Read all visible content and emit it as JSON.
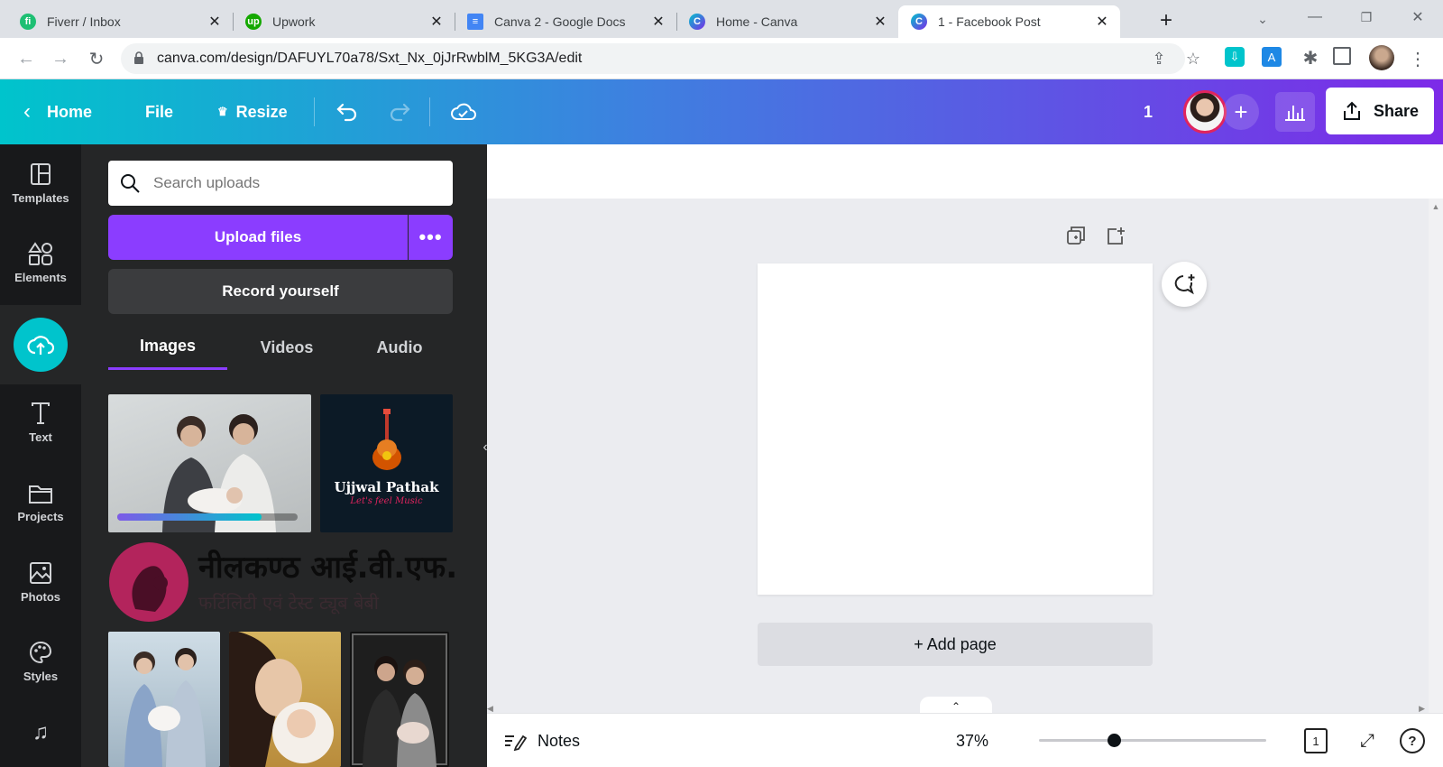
{
  "browser": {
    "tabs": [
      {
        "title": "Fiverr / Inbox",
        "favicon": "fiverr-icon",
        "color": "#1dbf73"
      },
      {
        "title": "Upwork",
        "favicon": "upwork-icon",
        "color": "#14a800"
      },
      {
        "title": "Canva 2 - Google Docs",
        "favicon": "google-docs-icon",
        "color": "#4285f4"
      },
      {
        "title": "Home - Canva",
        "favicon": "canva-icon",
        "color": "#00c4cc"
      },
      {
        "title": "1 - Facebook Post",
        "favicon": "canva-icon",
        "color": "#7d2ae8"
      }
    ],
    "url": "canva.com/design/DAFUYL70a78/Sxt_Nx_0jJrRwblM_5KG3A/edit"
  },
  "toolbar": {
    "home": "Home",
    "file": "File",
    "resize": "Resize",
    "page_count": "1",
    "share": "Share"
  },
  "rail": {
    "templates": "Templates",
    "elements": "Elements",
    "text": "Text",
    "projects": "Projects",
    "photos": "Photos",
    "styles": "Styles"
  },
  "uploads": {
    "search_placeholder": "Search uploads",
    "upload_button": "Upload files",
    "record_button": "Record yourself",
    "tabs": [
      "Images",
      "Videos",
      "Audio"
    ],
    "logo_text": "Ujjwal Pathak",
    "logo_tagline": "Let's feel Music",
    "banner_title": "नीलकण्ठ आई.वी.एफ.",
    "banner_sub": "फर्टिलिटी एवं टेस्ट ट्यूब बेबी",
    "upload_progress": 0.8
  },
  "canvas": {
    "add_page": "+ Add page"
  },
  "footer": {
    "notes": "Notes",
    "zoom": "37%",
    "page_indicator": "1"
  }
}
